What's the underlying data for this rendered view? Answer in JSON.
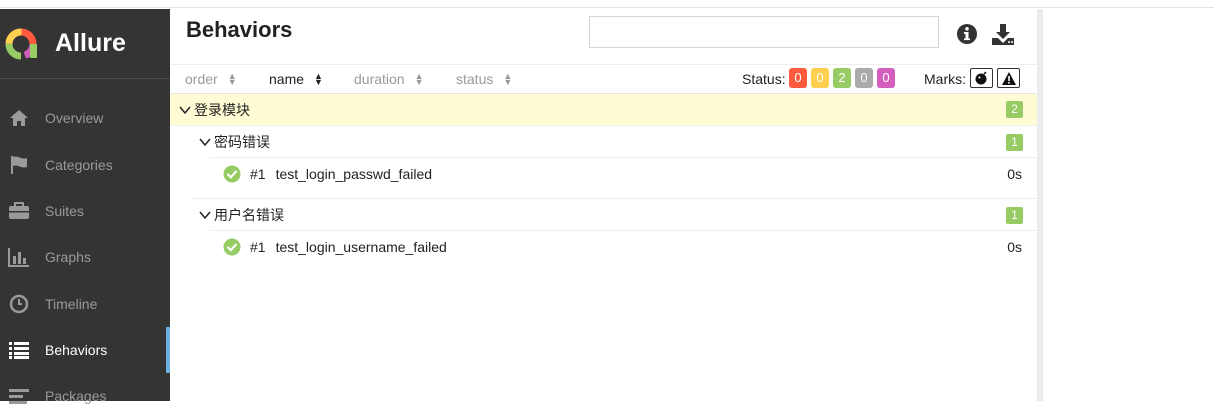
{
  "app": {
    "name": "Allure"
  },
  "sidebar": {
    "items": [
      {
        "label": "Overview",
        "icon": "home-icon"
      },
      {
        "label": "Categories",
        "icon": "flag-icon"
      },
      {
        "label": "Suites",
        "icon": "briefcase-icon"
      },
      {
        "label": "Graphs",
        "icon": "bar-chart-icon"
      },
      {
        "label": "Timeline",
        "icon": "clock-icon"
      },
      {
        "label": "Behaviors",
        "icon": "list-icon",
        "active": true
      },
      {
        "label": "Packages",
        "icon": "align-left-icon"
      }
    ]
  },
  "page": {
    "title": "Behaviors"
  },
  "search": {
    "value": "",
    "placeholder": ""
  },
  "sortbar": {
    "columns": [
      "order",
      "name",
      "duration",
      "status"
    ],
    "status_label": "Status:",
    "status_counts": [
      {
        "value": "0",
        "color": "#fd5a3e"
      },
      {
        "value": "0",
        "color": "#ffd050"
      },
      {
        "value": "2",
        "color": "#97cc64"
      },
      {
        "value": "0",
        "color": "#aaaaaa"
      },
      {
        "value": "0",
        "color": "#d35ebe"
      }
    ],
    "marks_label": "Marks:"
  },
  "tree": {
    "group": {
      "name": "登录模块",
      "count": "2"
    },
    "subgroups": [
      {
        "name": "密码错误",
        "count": "1",
        "test": {
          "num": "#1",
          "name": "test_login_passwd_failed",
          "duration": "0s"
        }
      },
      {
        "name": "用户名错误",
        "count": "1",
        "test": {
          "num": "#1",
          "name": "test_login_username_failed",
          "duration": "0s"
        }
      }
    ]
  }
}
